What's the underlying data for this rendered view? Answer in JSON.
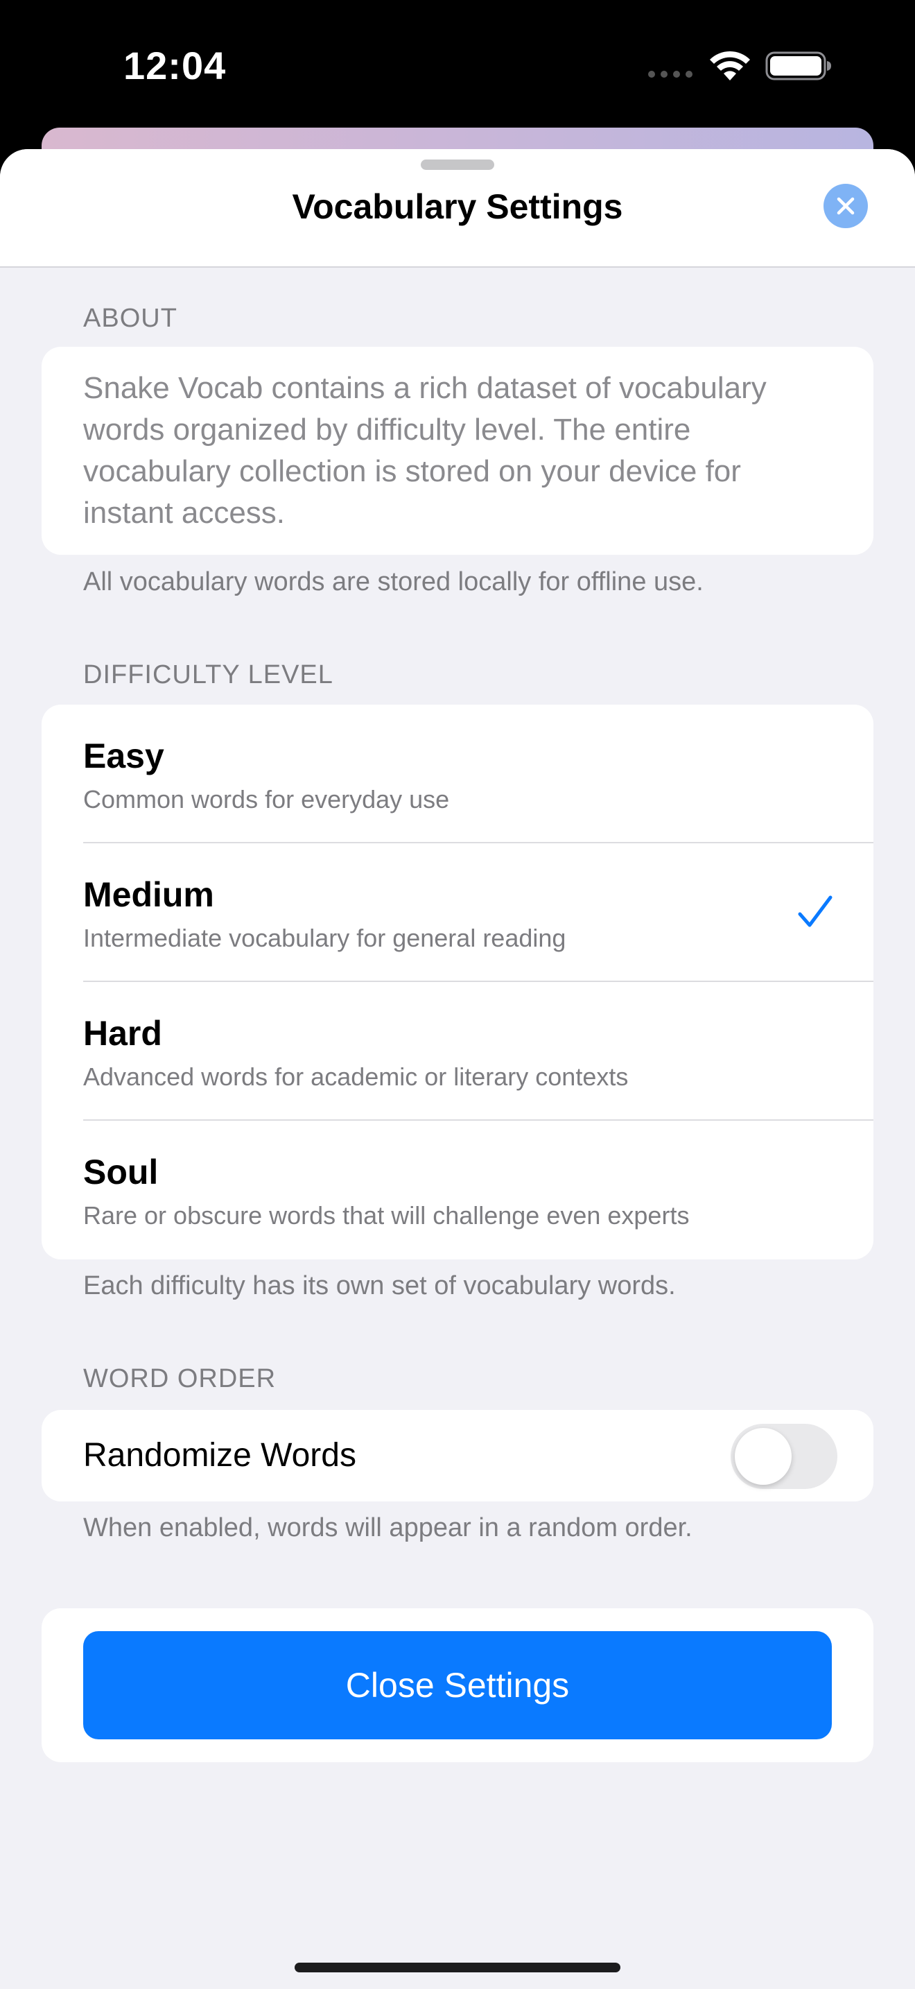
{
  "status_bar": {
    "time": "12:04"
  },
  "sheet": {
    "title": "Vocabulary Settings"
  },
  "about": {
    "header": "ABOUT",
    "text": "Snake Vocab contains a rich dataset of vocabulary words organized by difficulty level. The entire vocabulary collection is stored on your device for instant access.",
    "footer": "All vocabulary words are stored locally for offline use."
  },
  "difficulty": {
    "header": "DIFFICULTY LEVEL",
    "options": [
      {
        "name": "Easy",
        "description": "Common words for everyday use",
        "selected": false
      },
      {
        "name": "Medium",
        "description": "Intermediate vocabulary for general reading",
        "selected": true
      },
      {
        "name": "Hard",
        "description": "Advanced words for academic or literary contexts",
        "selected": false
      },
      {
        "name": "Soul",
        "description": "Rare or obscure words that will challenge even experts",
        "selected": false
      }
    ],
    "footer": "Each difficulty has its own set of vocabulary words."
  },
  "word_order": {
    "header": "WORD ORDER",
    "toggle_label": "Randomize Words",
    "toggle_on": false,
    "footer": "When enabled, words will appear in a random order."
  },
  "actions": {
    "close_button": "Close Settings"
  },
  "colors": {
    "accent": "#0a7aff",
    "sheet_background": "#f1f1f6",
    "card_background": "#ffffff",
    "secondary_text": "#7c7c80"
  },
  "icons": {
    "close": "close-icon",
    "checkmark": "checkmark-icon",
    "wifi": "wifi-icon",
    "battery": "battery-icon"
  }
}
